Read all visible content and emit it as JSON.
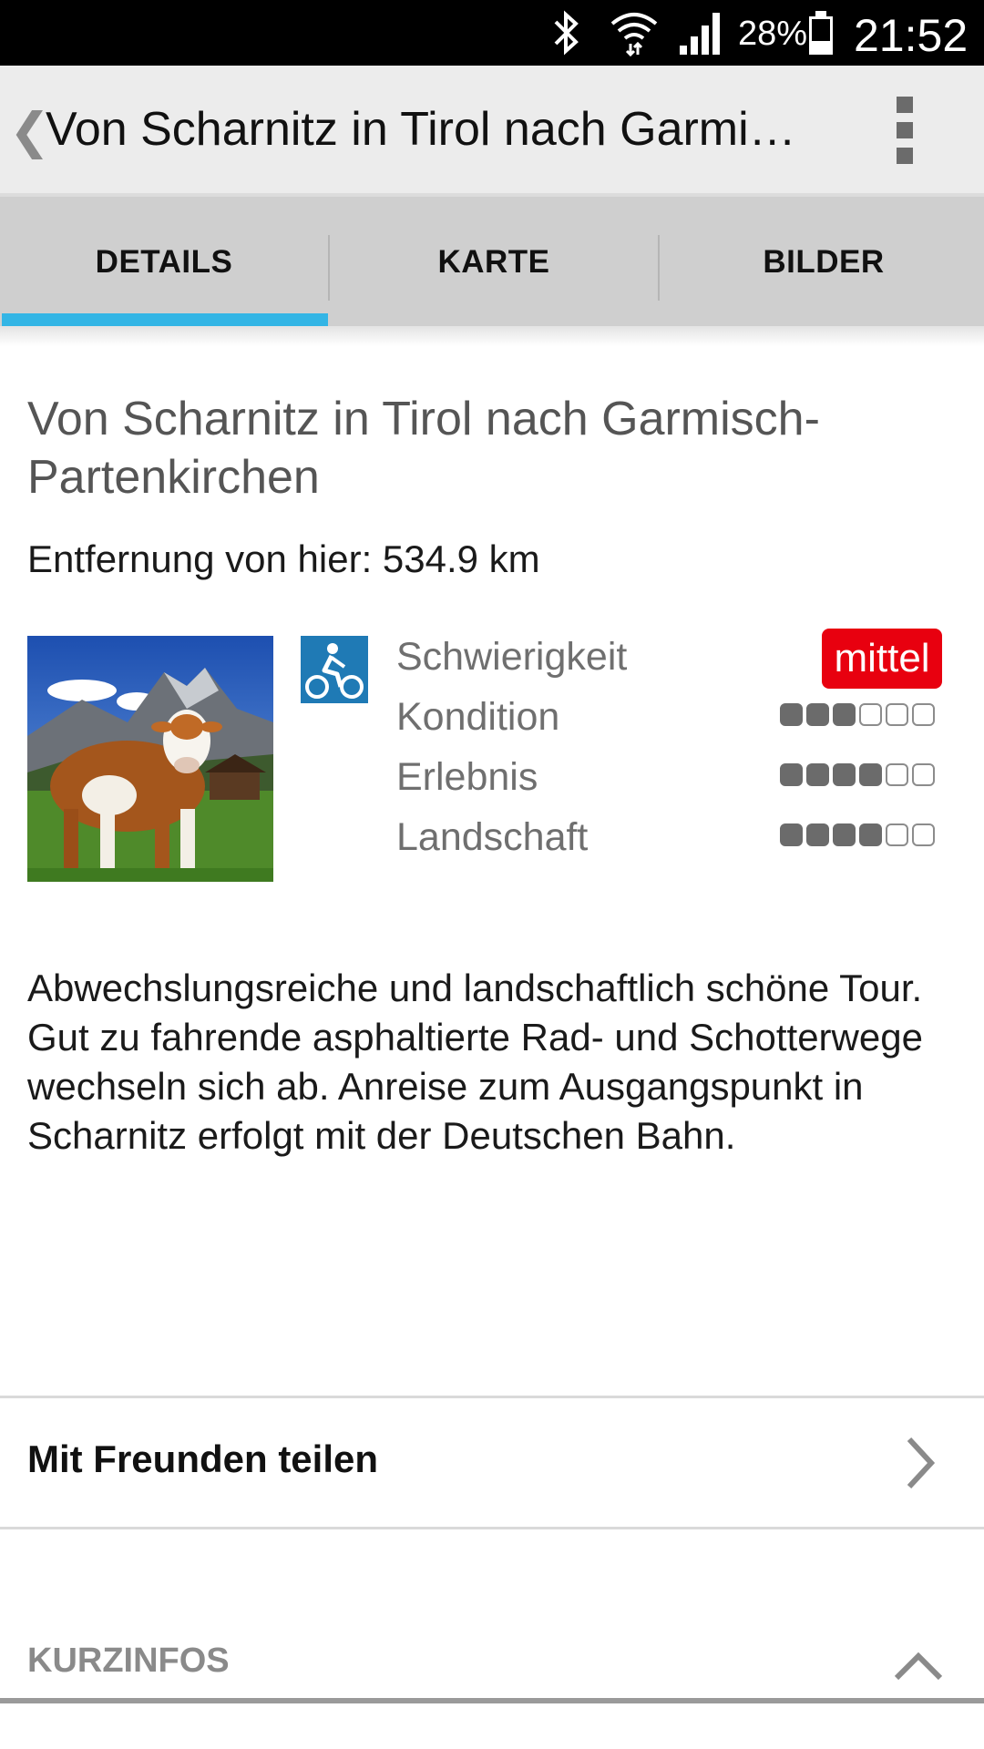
{
  "status_bar": {
    "battery_percent": "28%",
    "time": "21:52",
    "icons": [
      "bluetooth-icon",
      "wifi-icon",
      "signal-icon",
      "battery-icon"
    ]
  },
  "action_bar": {
    "title": "Von Scharnitz in Tirol nach Garmi…"
  },
  "tabs": [
    {
      "label": "DETAILS",
      "selected": true
    },
    {
      "label": "KARTE",
      "selected": false
    },
    {
      "label": "BILDER",
      "selected": false
    }
  ],
  "details": {
    "tour_title": "Von Scharnitz in Tirol nach Garmisch-Partenkirchen",
    "distance": "Entfernung von hier: 534.9 km",
    "activity_icon": "bicycle-icon",
    "ratings": {
      "difficulty": {
        "label": "Schwierigkeit",
        "value": "mittel"
      },
      "condition": {
        "label": "Kondition",
        "value": 3,
        "max": 6
      },
      "experience": {
        "label": "Erlebnis",
        "value": 4,
        "max": 6
      },
      "landscape": {
        "label": "Landschaft",
        "value": 4,
        "max": 6
      }
    },
    "description": "Abwechslungsreiche und landschaftlich schöne Tour. Gut zu fahrende asphaltierte Rad- und Schotterwege wechseln sich ab. Anreise zum Ausgangspunkt in Scharnitz erfolgt mit der Deutschen Bahn."
  },
  "share": {
    "label": "Mit Freunden teilen"
  },
  "kurzinfos": {
    "label": "KURZINFOS"
  },
  "colors": {
    "accent": "#33b5e5",
    "difficulty_badge": "#e8000f",
    "activity_icon_bg": "#1f7ab5"
  }
}
